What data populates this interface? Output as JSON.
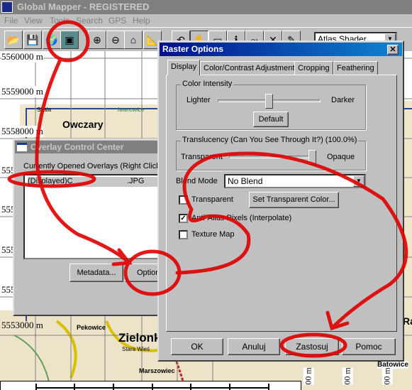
{
  "app": {
    "title": "Global Mapper - REGISTERED"
  },
  "menu": [
    "File",
    "View",
    "Tools",
    "Search",
    "GPS",
    "Help"
  ],
  "toolbar": {
    "shader_select": "Atlas Shader",
    "icons": [
      "open-folder-icon",
      "save-icon",
      "globe-icon",
      "overlay-control-icon",
      "zoom-in-icon",
      "zoom-out-icon",
      "home-icon",
      "measure-icon",
      "digitizer-icon",
      "pan-hand-icon",
      "zoom-box-icon",
      "info-icon",
      "path-profile-icon",
      "view-shed-icon",
      "pencil-icon"
    ]
  },
  "map": {
    "y_labels": [
      "5560000 m",
      "5559000 m",
      "5558000 m",
      "555",
      "555",
      "555",
      "555",
      "5553000 m"
    ],
    "x_labels": [
      "00 m",
      "00 m",
      "00 m"
    ],
    "places": [
      "Owczary",
      "Skala",
      "Iwanowice",
      "Pekowice",
      "Zielonki",
      "Stara Wieś",
      "Marszowiec",
      "Batowice",
      "Ra"
    ]
  },
  "overlay_window": {
    "title": "Overlay Control Center",
    "list_label": "Currently Opened Overlays (Right Click o",
    "items": [
      {
        "prefix": "(Displayed)C",
        "suffix": ".JPG"
      }
    ],
    "metadata_button": "Metadata...",
    "options_button": "Option"
  },
  "raster_dialog": {
    "title": "Raster Options",
    "tabs": [
      "Display",
      "Color/Contrast Adjustment",
      "Cropping",
      "Feathering"
    ],
    "active_tab": "Display",
    "color_intensity": {
      "label": "Color Intensity",
      "left": "Lighter",
      "right": "Darker",
      "value_fraction": 0.5,
      "default_button": "Default"
    },
    "translucency": {
      "label": "Translucency (Can You See Through It?) (100.0%)",
      "left": "Transparent",
      "right": "Opaque",
      "value_percent": 100
    },
    "blend_mode": {
      "label": "Blend Mode",
      "value": "No Blend"
    },
    "transparent": {
      "label": "Transparent",
      "checked": false,
      "button": "Set Transparent Color..."
    },
    "anti_alias": {
      "label": "Anti-Alias Pixels (Interpolate)",
      "checked": true
    },
    "texture_map": {
      "label": "Texture Map",
      "checked": false
    },
    "buttons": {
      "ok": "OK",
      "cancel": "Anuluj",
      "apply": "Zastosuj",
      "help": "Pomoc"
    }
  },
  "annotation_color": "#e00000"
}
